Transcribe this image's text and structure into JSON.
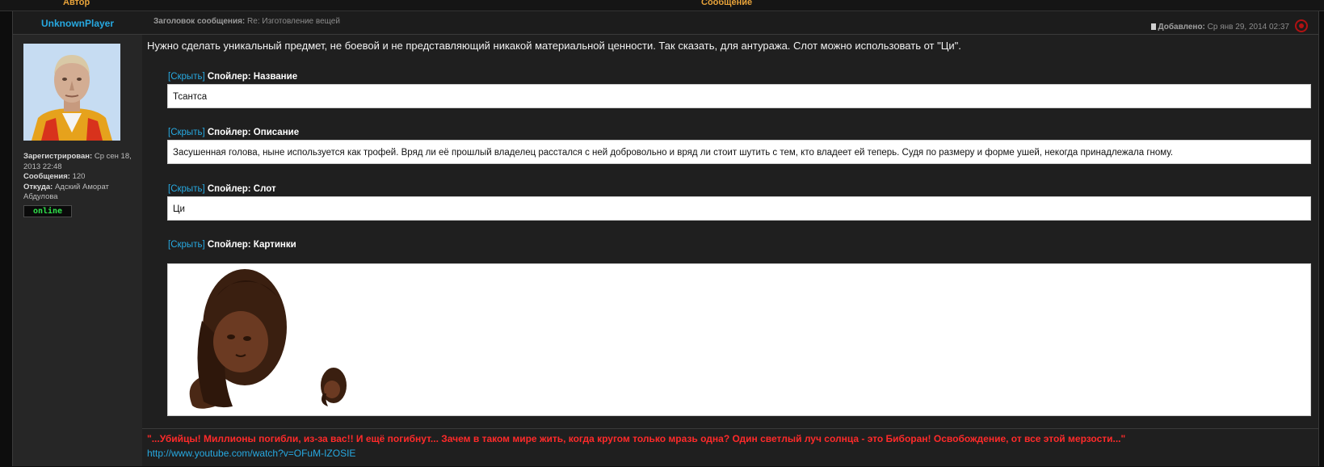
{
  "header": {
    "author_label": "Автор",
    "message_label": "Сообщение"
  },
  "author": {
    "name": "UnknownPlayer",
    "registered_label": "Зарегистрирован:",
    "registered_value": "Ср сен 18, 2013 22:48",
    "posts_label": "Сообщения:",
    "posts_value": "120",
    "from_label": "Откуда:",
    "from_value": "Адский Аморат Абдулова",
    "status": "online"
  },
  "post": {
    "title_label": "Заголовок сообщения:",
    "title_value": "Re: Изготовление вещей",
    "posted_label": "Добавлено:",
    "posted_value": "Ср янв 29, 2014 02:37",
    "intro": "Нужно сделать уникальный предмет, не боевой и не представляющий никакой материальной ценности. Так сказать, для антуража. Слот можно использовать от \"Ци\".",
    "spoilers": [
      {
        "toggle": "[Скрыть]",
        "title": "Спойлер: Название",
        "content": "Тсантса"
      },
      {
        "toggle": "[Скрыть]",
        "title": "Спойлер: Описание",
        "content": "Засушенная голова, ныне используется как трофей. Вряд ли её прошлый владелец расстался с ней добровольно и вряд ли стоит шутить с тем, кто владеет ей теперь. Судя по размеру и форме ушей, некогда принадлежала гному."
      },
      {
        "toggle": "[Скрыть]",
        "title": "Спойлер: Слот",
        "content": "Ци"
      },
      {
        "toggle": "[Скрыть]",
        "title": "Спойлер: Картинки",
        "content": ""
      }
    ]
  },
  "signature": {
    "quote": "\"...Убийцы! Миллионы погибли, из-за вас!! И ещё погибнут... Зачем в таком мире жить, когда кругом только мразь одна? Один светлый луч солнца - это Биборан! Освобождение, от все этой мерзости...\"",
    "link": "http://www.youtube.com/watch?v=OFuM-IZOSIE"
  },
  "colors": {
    "accent_link": "#27a9e1",
    "header_gold": "#e8a33a",
    "signature_red": "#ff2a2a",
    "online_green": "#2fe04a"
  },
  "icons": {
    "post_icon": "document-icon",
    "emblem": "emblem-icon"
  }
}
